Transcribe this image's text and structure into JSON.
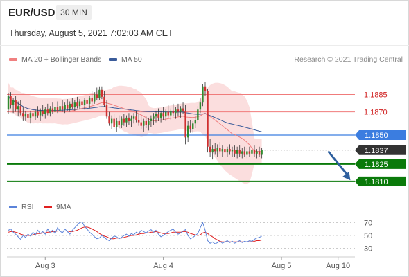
{
  "header": {
    "symbol": "EUR/USD",
    "timeframe": "30 MIN",
    "timestamp": "Thursday, August 5, 2021 7:02:03 AM CET"
  },
  "legend": {
    "ma20_label": "MA 20 + Bollinger Bands",
    "ma50_label": "MA 50",
    "rsi_label": "RSI",
    "rsi_ma_label": "9MA",
    "credit": "Research © 2021 Trading Central"
  },
  "colors": {
    "ma20": "#f08080",
    "ma50": "#3a5b9a",
    "bollinger_fill": "#fbdada",
    "resistance": "#f07b7b",
    "pivot": "#3b7de0",
    "support": "#0a7a0a",
    "last_price": "#333333",
    "arrow": "#2e5f9e",
    "rsi": "#5b83d9",
    "rsi_ma": "#e02020",
    "candle_up": "#2f8a2f",
    "candle_down": "#d03030"
  },
  "chart_data": {
    "type": "candlestick",
    "title": "",
    "x_ticks": [
      {
        "label": "Aug 3",
        "bar": 15
      },
      {
        "label": "Aug 4",
        "bar": 63
      },
      {
        "label": "Aug 5",
        "bar": 111
      },
      {
        "label": "Aug 10",
        "bar": 134
      }
    ],
    "ylim": [
      1.1798,
      1.1908
    ],
    "levels": [
      {
        "label": "1.1885",
        "value": 1.1885,
        "kind": "resistance"
      },
      {
        "label": "1.1870",
        "value": 1.187,
        "kind": "resistance"
      },
      {
        "label": "1.1850",
        "value": 1.185,
        "kind": "pivot"
      },
      {
        "label": "1.1837",
        "value": 1.1837,
        "kind": "last"
      },
      {
        "label": "1.1825",
        "value": 1.1825,
        "kind": "support"
      },
      {
        "label": "1.1810",
        "value": 1.181,
        "kind": "support"
      }
    ],
    "forecast_arrow": {
      "from_bar": 130,
      "from": 1.1836,
      "to_bar": 139,
      "to": 1.1811
    },
    "ohlc": [
      [
        1.1872,
        1.1886,
        1.1868,
        1.1884
      ],
      [
        1.1884,
        1.1887,
        1.1873,
        1.1876
      ],
      [
        1.1876,
        1.1882,
        1.1869,
        1.188
      ],
      [
        1.188,
        1.1884,
        1.187,
        1.1872
      ],
      [
        1.1872,
        1.1879,
        1.1866,
        1.1875
      ],
      [
        1.1875,
        1.188,
        1.1867,
        1.1869
      ],
      [
        1.1869,
        1.1874,
        1.1862,
        1.1866
      ],
      [
        1.1866,
        1.1871,
        1.1862,
        1.1868
      ],
      [
        1.1868,
        1.1873,
        1.1863,
        1.1865
      ],
      [
        1.1865,
        1.1871,
        1.186,
        1.1869
      ],
      [
        1.1869,
        1.1874,
        1.1864,
        1.1866
      ],
      [
        1.1866,
        1.1872,
        1.1863,
        1.187
      ],
      [
        1.187,
        1.1875,
        1.1865,
        1.1867
      ],
      [
        1.1867,
        1.1873,
        1.1862,
        1.1871
      ],
      [
        1.1871,
        1.1876,
        1.1866,
        1.1868
      ],
      [
        1.1868,
        1.1874,
        1.1864,
        1.1872
      ],
      [
        1.1872,
        1.1877,
        1.1867,
        1.1869
      ],
      [
        1.1869,
        1.1875,
        1.1866,
        1.1873
      ],
      [
        1.1873,
        1.1878,
        1.1868,
        1.187
      ],
      [
        1.187,
        1.1876,
        1.1867,
        1.1874
      ],
      [
        1.1874,
        1.1879,
        1.1869,
        1.1871
      ],
      [
        1.1871,
        1.1877,
        1.1868,
        1.1875
      ],
      [
        1.1875,
        1.188,
        1.187,
        1.1872
      ],
      [
        1.1872,
        1.1878,
        1.1869,
        1.1876
      ],
      [
        1.1876,
        1.1881,
        1.1871,
        1.1873
      ],
      [
        1.1873,
        1.1879,
        1.187,
        1.1877
      ],
      [
        1.1877,
        1.1882,
        1.1872,
        1.1874
      ],
      [
        1.1874,
        1.188,
        1.1871,
        1.1878
      ],
      [
        1.1878,
        1.1883,
        1.1873,
        1.1875
      ],
      [
        1.1875,
        1.1881,
        1.1872,
        1.1879
      ],
      [
        1.1879,
        1.1884,
        1.1874,
        1.1876
      ],
      [
        1.1876,
        1.1882,
        1.1872,
        1.188
      ],
      [
        1.188,
        1.1885,
        1.1874,
        1.1877
      ],
      [
        1.1877,
        1.1884,
        1.1873,
        1.1882
      ],
      [
        1.1882,
        1.1888,
        1.1876,
        1.1879
      ],
      [
        1.1879,
        1.1887,
        1.1877,
        1.1885
      ],
      [
        1.1885,
        1.1891,
        1.188,
        1.1882
      ],
      [
        1.1882,
        1.1892,
        1.188,
        1.1889
      ],
      [
        1.1889,
        1.1892,
        1.1881,
        1.1883
      ],
      [
        1.1883,
        1.1888,
        1.1874,
        1.1876
      ],
      [
        1.1876,
        1.188,
        1.1864,
        1.1866
      ],
      [
        1.1866,
        1.187,
        1.1858,
        1.186
      ],
      [
        1.186,
        1.1867,
        1.1855,
        1.1864
      ],
      [
        1.1864,
        1.1868,
        1.1855,
        1.1857
      ],
      [
        1.1857,
        1.1865,
        1.1853,
        1.1862
      ],
      [
        1.1862,
        1.1867,
        1.1856,
        1.1859
      ],
      [
        1.1859,
        1.1866,
        1.1856,
        1.1864
      ],
      [
        1.1864,
        1.1868,
        1.1858,
        1.1861
      ],
      [
        1.1861,
        1.1867,
        1.1857,
        1.1865
      ],
      [
        1.1865,
        1.1869,
        1.1859,
        1.1862
      ],
      [
        1.1862,
        1.1867,
        1.1857,
        1.1864
      ],
      [
        1.1864,
        1.1869,
        1.186,
        1.1866
      ],
      [
        1.1866,
        1.1871,
        1.1861,
        1.1863
      ],
      [
        1.1863,
        1.1868,
        1.1858,
        1.1861
      ],
      [
        1.1861,
        1.1866,
        1.1855,
        1.1858
      ],
      [
        1.1858,
        1.1864,
        1.1853,
        1.1862
      ],
      [
        1.1862,
        1.1866,
        1.1856,
        1.1859
      ],
      [
        1.1859,
        1.1865,
        1.1854,
        1.1862
      ],
      [
        1.1862,
        1.1867,
        1.1857,
        1.1864
      ],
      [
        1.1864,
        1.1869,
        1.1859,
        1.1866
      ],
      [
        1.1866,
        1.1871,
        1.1861,
        1.1868
      ],
      [
        1.1868,
        1.1873,
        1.1862,
        1.1865
      ],
      [
        1.1865,
        1.1871,
        1.1861,
        1.1869
      ],
      [
        1.1869,
        1.1874,
        1.1863,
        1.1866
      ],
      [
        1.1866,
        1.1872,
        1.1862,
        1.187
      ],
      [
        1.187,
        1.1876,
        1.1865,
        1.1867
      ],
      [
        1.1867,
        1.1873,
        1.1863,
        1.1871
      ],
      [
        1.1871,
        1.1877,
        1.1866,
        1.1869
      ],
      [
        1.1869,
        1.1874,
        1.1864,
        1.1872
      ],
      [
        1.1872,
        1.1877,
        1.1866,
        1.187
      ],
      [
        1.187,
        1.1875,
        1.1865,
        1.1873
      ],
      [
        1.1873,
        1.1878,
        1.1868,
        1.1871
      ],
      [
        1.1871,
        1.1876,
        1.1842,
        1.1848
      ],
      [
        1.1848,
        1.1862,
        1.1844,
        1.1858
      ],
      [
        1.1858,
        1.1863,
        1.1852,
        1.1855
      ],
      [
        1.1855,
        1.1862,
        1.1852,
        1.186
      ],
      [
        1.186,
        1.1866,
        1.1856,
        1.1863
      ],
      [
        1.1863,
        1.1875,
        1.186,
        1.1872
      ],
      [
        1.1872,
        1.1882,
        1.1869,
        1.1878
      ],
      [
        1.1878,
        1.1894,
        1.1875,
        1.1892
      ],
      [
        1.1892,
        1.1896,
        1.1884,
        1.1888
      ],
      [
        1.1888,
        1.189,
        1.1835,
        1.184
      ],
      [
        1.184,
        1.1847,
        1.1831,
        1.1835
      ],
      [
        1.1835,
        1.1841,
        1.1829,
        1.1838
      ],
      [
        1.1838,
        1.1843,
        1.1833,
        1.1836
      ],
      [
        1.1836,
        1.1842,
        1.1831,
        1.1839
      ],
      [
        1.1839,
        1.1844,
        1.1834,
        1.1836
      ],
      [
        1.1836,
        1.1841,
        1.1831,
        1.1838
      ],
      [
        1.1838,
        1.1842,
        1.1833,
        1.1835
      ],
      [
        1.1835,
        1.184,
        1.1831,
        1.1838
      ],
      [
        1.1838,
        1.1842,
        1.1833,
        1.1836
      ],
      [
        1.1836,
        1.184,
        1.1831,
        1.1837
      ],
      [
        1.1837,
        1.1841,
        1.1831,
        1.1834
      ],
      [
        1.1834,
        1.184,
        1.183,
        1.1837
      ],
      [
        1.1837,
        1.1841,
        1.1831,
        1.1834
      ],
      [
        1.1834,
        1.1839,
        1.183,
        1.1836
      ],
      [
        1.1836,
        1.184,
        1.1831,
        1.1833
      ],
      [
        1.1833,
        1.1839,
        1.183,
        1.1836
      ],
      [
        1.1836,
        1.184,
        1.1831,
        1.1834
      ],
      [
        1.1834,
        1.1839,
        1.183,
        1.1837
      ],
      [
        1.1837,
        1.1841,
        1.1831,
        1.1834
      ],
      [
        1.1834,
        1.1838,
        1.183,
        1.1836
      ],
      [
        1.1836,
        1.184,
        1.1831,
        1.1833
      ],
      [
        1.1833,
        1.1839,
        1.183,
        1.1837
      ]
    ],
    "rsi": {
      "ylim": [
        20,
        80
      ],
      "ticks": [
        70,
        50,
        30
      ],
      "rsi": [
        58,
        60,
        55,
        52,
        48,
        44,
        50,
        47,
        52,
        49,
        55,
        51,
        58,
        53,
        56,
        52,
        60,
        55,
        58,
        53,
        62,
        57,
        54,
        60,
        56,
        52,
        58,
        62,
        66,
        70,
        71,
        64,
        60,
        55,
        52,
        48,
        45,
        46,
        50,
        47,
        44,
        42,
        46,
        49,
        48,
        45,
        47,
        50,
        52,
        49,
        53,
        51,
        55,
        53,
        58,
        56,
        54,
        57,
        59,
        55,
        58,
        52,
        48,
        50,
        53,
        56,
        58,
        60,
        55,
        52,
        54,
        57,
        59,
        50,
        45,
        47,
        50,
        53,
        62,
        70,
        58,
        42,
        38,
        40,
        37,
        39,
        41,
        38,
        40,
        42,
        39,
        41,
        38,
        40,
        42,
        39,
        41,
        40,
        42,
        41,
        44,
        46,
        47,
        49
      ],
      "ma": [
        55,
        56,
        56,
        55,
        54,
        52,
        51,
        50,
        50,
        50,
        51,
        52,
        53,
        53,
        54,
        54,
        55,
        55,
        56,
        56,
        57,
        57,
        57,
        57,
        57,
        56,
        56,
        57,
        58,
        60,
        62,
        63,
        63,
        62,
        60,
        58,
        56,
        53,
        51,
        49,
        48,
        46,
        45,
        45,
        46,
        46,
        46,
        47,
        48,
        49,
        50,
        50,
        51,
        52,
        53,
        53,
        54,
        54,
        55,
        55,
        56,
        55,
        54,
        53,
        53,
        53,
        54,
        55,
        55,
        55,
        55,
        56,
        56,
        55,
        53,
        52,
        51,
        50,
        51,
        54,
        55,
        53,
        50,
        48,
        45,
        43,
        41,
        40,
        40,
        40,
        40,
        40,
        40,
        40,
        40,
        40,
        40,
        40,
        40,
        40,
        41,
        42,
        42,
        43
      ]
    }
  }
}
